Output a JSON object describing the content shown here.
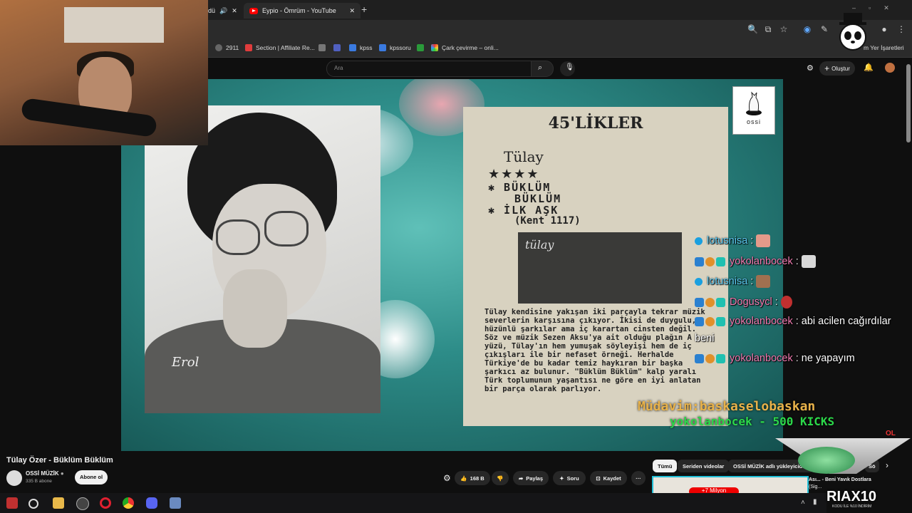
{
  "browser": {
    "tabs": [
      {
        "label": "dü"
      },
      {
        "label": "Eypio - Ömrüm - YouTube"
      }
    ],
    "new_tab": "+",
    "bookmarks": [
      {
        "label": "2911"
      },
      {
        "label": "Section | Affiliate Re..."
      },
      {
        "label": "kpss"
      },
      {
        "label": "kpssoru"
      },
      {
        "label": "Çark çevirme – onli..."
      },
      {
        "label": "m Yer İşaretleri"
      }
    ]
  },
  "youtube": {
    "search_placeholder": "Ara",
    "create_label": "Oluştur"
  },
  "video": {
    "newspaper": {
      "header": "45'LİKLER",
      "artist": "Tülay",
      "stars": "★★★★",
      "track1": "✱ BÜKLÜM",
      "track1b": "BÜKLÜM",
      "track2": "✱ İLK AŞK",
      "catalog": "(Kent 1117)",
      "cover_text": "tülay",
      "body": "Tülay kendisine yakışan iki parçayla tekrar müzik severlerin karşısına çıkıyor. İkisi de duygulu, hüzünlü şarkılar ama iç karartan cinsten değil. Söz ve müzik Sezen Aksu'ya ait olduğu plağın A yüzü, Tülay'ın hem yumuşak söyleyişi hem de iç çıkışları ile bir nefaset örneği. Herhalde Türkiye'de bu kadar temiz haykıran bir başka şarkıcı az bulunur. \"Büklüm Büklüm\" kalp yaralı Türk toplumunun yaşantısı ne göre en iyi anlatan bir parça olarak parlıyor."
    },
    "photo_signature": "Erol",
    "logo": "ossi"
  },
  "chat": [
    {
      "user": "lotusnisa",
      "text": "",
      "color": "#5cc8f0"
    },
    {
      "user": "yokolanbocek",
      "text": "",
      "color": "#f07ab0"
    },
    {
      "user": "lotusnisa",
      "text": "",
      "color": "#5cc8f0"
    },
    {
      "user": "Dogusycl",
      "text": "",
      "color": "#f07ab0"
    },
    {
      "user": "yokolanbocek",
      "text": "abi acilen cağırdılar",
      "color": "#f07ab0"
    },
    {
      "user": "",
      "text": "beni",
      "color": "#ffffff"
    },
    {
      "user": "yokolanbocek",
      "text": "ne yapayım",
      "color": "#f07ab0"
    }
  ],
  "overlay": {
    "mudavim": "Müdavim:baskaselobaskan",
    "kicks": "yokolanbocek - 500 KICKS",
    "ol": "OL",
    "riax": "RIAX10",
    "riax_sub": "KODU İLE %10 İNDİRİM"
  },
  "below": {
    "title": "Tülay Özer - Büklüm Büklüm",
    "channel": "OSSİ MÜZİK",
    "subs": "335 B abone",
    "subscribe": "Abone ol",
    "likes": "168 B",
    "share": "Paylaş",
    "ask": "Soru",
    "save": "Kaydet",
    "more": "···",
    "chips": [
      "Tümü",
      "Seriden videolar",
      "OSSİ MÜZİK adlı yükleyiciden",
      "Sö"
    ],
    "chip_partial": "zel",
    "rec_badge": "+7 Milyon",
    "rec_title": "Ası... - Beni Yavık Dostlara",
    "rec_sub": "(Sig..."
  }
}
